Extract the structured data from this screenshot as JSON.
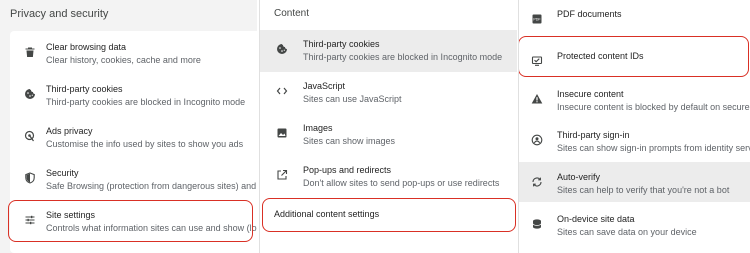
{
  "privacy": {
    "title": "Privacy and security",
    "items": [
      {
        "title": "Clear browsing data",
        "subtitle": "Clear history, cookies, cache and more",
        "icon": "trash-icon"
      },
      {
        "title": "Third-party cookies",
        "subtitle": "Third-party cookies are blocked in Incognito mode",
        "icon": "cookie-icon"
      },
      {
        "title": "Ads privacy",
        "subtitle": "Customise the info used by sites to show you ads",
        "icon": "ads-privacy-icon"
      },
      {
        "title": "Security",
        "subtitle": "Safe Browsing (protection from dangerous sites) and o",
        "icon": "shield-icon"
      },
      {
        "title": "Site settings",
        "subtitle": "Controls what information sites can use and show (loc",
        "icon": "sliders-icon"
      }
    ]
  },
  "content": {
    "title": "Content",
    "items": [
      {
        "title": "Third-party cookies",
        "subtitle": "Third-party cookies are blocked in Incognito mode",
        "icon": "cookie-icon"
      },
      {
        "title": "JavaScript",
        "subtitle": "Sites can use JavaScript",
        "icon": "code-icon"
      },
      {
        "title": "Images",
        "subtitle": "Sites can show images",
        "icon": "image-icon"
      },
      {
        "title": "Pop-ups and redirects",
        "subtitle": "Don't allow sites to send pop-ups or use redirects",
        "icon": "open-external-icon"
      }
    ],
    "additional": "Additional content settings"
  },
  "additional": {
    "items": [
      {
        "title": "PDF documents",
        "subtitle": "",
        "icon": "pdf-icon"
      },
      {
        "title": "Protected content IDs",
        "subtitle": "",
        "icon": "protected-content-icon"
      },
      {
        "title": "Insecure content",
        "subtitle": "Insecure content is blocked by default on secure sit",
        "icon": "warning-icon"
      },
      {
        "title": "Third-party sign-in",
        "subtitle": "Sites can show sign-in prompts from identity service",
        "icon": "account-icon"
      },
      {
        "title": "Auto-verify",
        "subtitle": "Sites can help to verify that you're not a bot",
        "icon": "auto-verify-icon"
      },
      {
        "title": "On-device site data",
        "subtitle": "Sites can save data on your device",
        "icon": "database-icon"
      }
    ]
  },
  "colors": {
    "highlight": "#d93025",
    "selected_row": "#ececec"
  }
}
